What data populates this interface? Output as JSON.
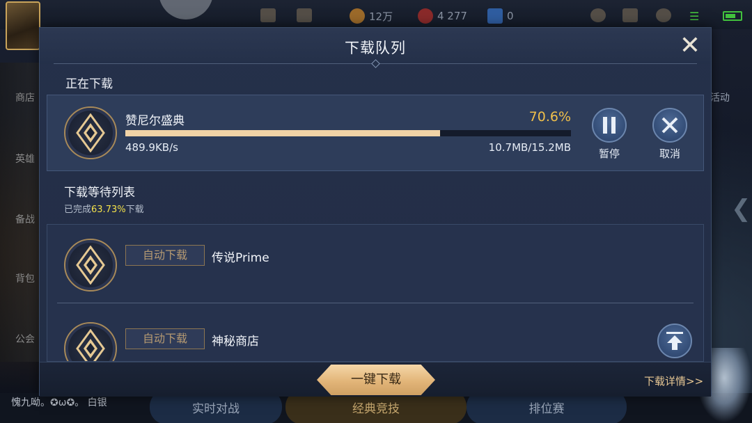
{
  "status_bar": {
    "coins": "12万",
    "gems": "4 277",
    "vouchers": "0"
  },
  "background": {
    "side_labels": [
      "商店",
      "英雄",
      "备战",
      "背包",
      "公会"
    ],
    "right_label": "活动",
    "chat_text": "愧九呦。✪ω✪。 白银",
    "bottom_tabs": [
      "实时对战",
      "经典竞技",
      "排位赛"
    ]
  },
  "dialog": {
    "title": "下载队列",
    "current_section_label": "正在下载",
    "current": {
      "name": "赞尼尔盛典",
      "percent_text": "70.6%",
      "progress": 0.706,
      "speed": "489.9KB/s",
      "size": "10.7MB/15.2MB",
      "pause_label": "暂停",
      "cancel_label": "取消"
    },
    "queue_section_label": "下载等待列表",
    "queue_progress": {
      "prefix": "已完成",
      "value": "63.73%",
      "suffix": "下载"
    },
    "queue": [
      {
        "tag": "自动下载",
        "name": "传说Prime"
      },
      {
        "tag": "自动下载",
        "name": "神秘商店"
      }
    ],
    "one_click_label": "一键下载",
    "detail_link": "下载详情>>"
  },
  "colors": {
    "accent_gold": "#f1c04a",
    "progress_fill": "#f1d3a6",
    "highlight_yellow": "#f4e14a"
  }
}
